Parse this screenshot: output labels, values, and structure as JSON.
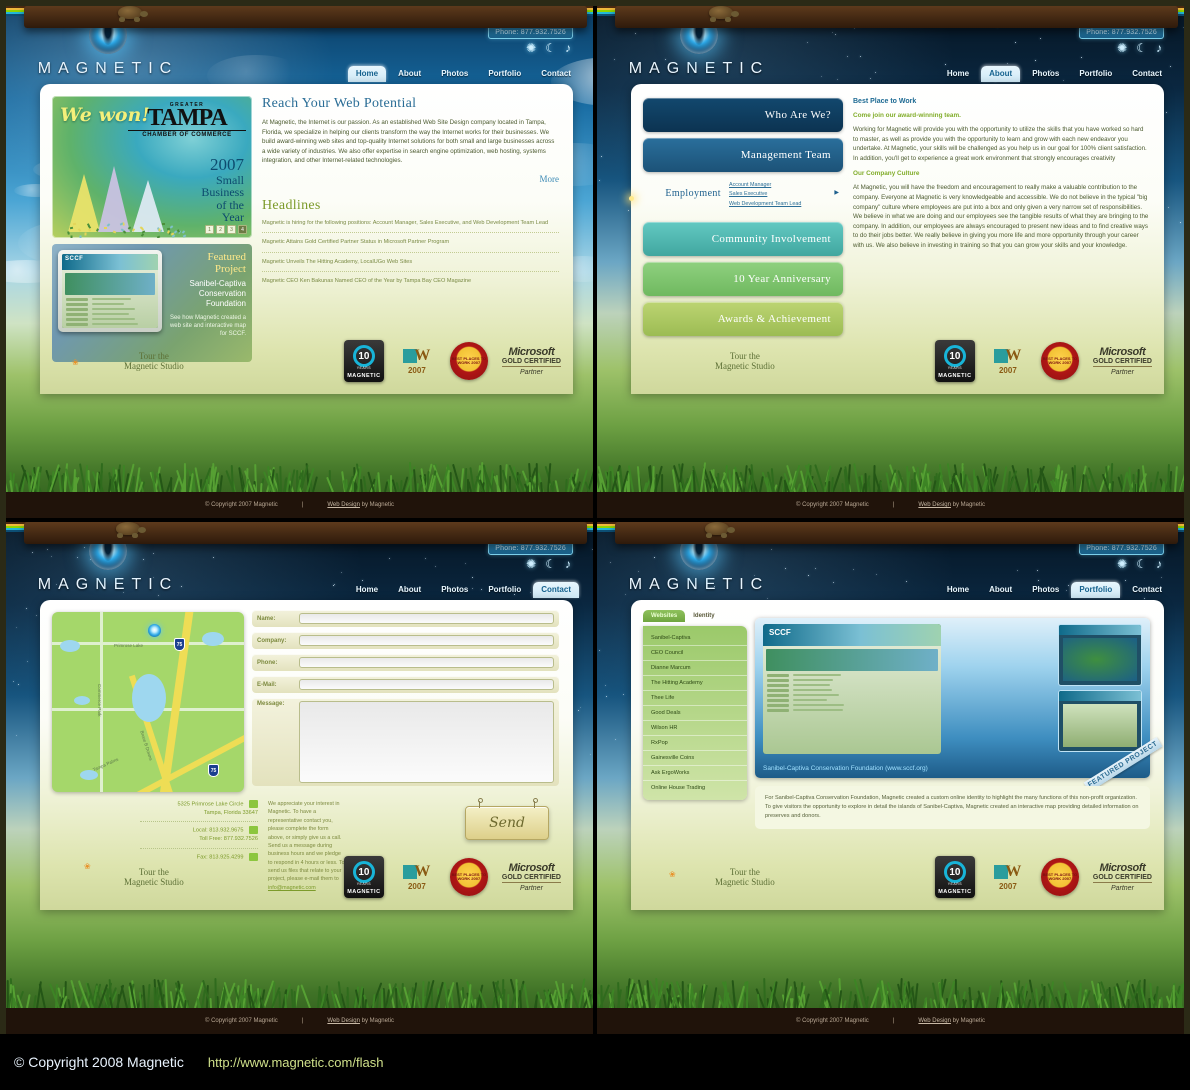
{
  "site": {
    "brand": "MAGNETIC",
    "phone_label": "Phone: 877.932.7526",
    "footer_copyright": "© Copyright 2007 Magnetic",
    "footer_sep": "|",
    "footer_credit_link": "Web Design",
    "footer_credit_rest": "by Magnetic",
    "footer_credit_by": "Magnetic",
    "tour_line1": "Tour the",
    "tour_line2": "Magnetic Studio",
    "mode_icons": [
      "sun-icon",
      "moon-icon",
      "music-note-icon"
    ],
    "nav": [
      "Home",
      "About",
      "Photos",
      "Portfolio",
      "Contact"
    ]
  },
  "badges": {
    "ten_number": "10",
    "ten_years": "YEARS",
    "ten_anniversary": "ANNIVERSARY",
    "ten_name": "MAGNETIC",
    "webby_w": "W",
    "webby_year": "2007",
    "seal_text": "BEST PLACES TO WORK 2007",
    "ms_brand": "Microsoft",
    "ms_gold": "GOLD CERTIFIED",
    "ms_partner": "Partner"
  },
  "home": {
    "active_tab": "Home",
    "hero": {
      "we_won": "We won!",
      "greater": "GREATER",
      "tampa": "TAMPA",
      "chamber": "CHAMBER OF COMMERCE",
      "year": "2007",
      "line1": "Small",
      "line2": "Business",
      "line3": "of the",
      "line4": "Year",
      "dots": [
        "1",
        "2",
        "3",
        "4"
      ]
    },
    "featured": {
      "title_line1": "Featured",
      "title_line2": "Project",
      "name": "Sanibel-Captiva Conservation Foundation",
      "desc": "See how Magnetic created a web site and interactive map for SCCF.",
      "screen_brand": "SCCF"
    },
    "reach": {
      "title": "Reach Your Web Potential",
      "body": "At Magnetic, the Internet is our passion. As an established Web Site Design company located in Tampa, Florida, we specialize in helping our clients transform the way the Internet works for their businesses. We build award-winning web sites and top-quality Internet solutions for both small and large businesses across a wide variety of industries. We also offer expertise in search engine optimization, web hosting, systems integration, and other Internet-related technologies.",
      "more": "More"
    },
    "headlines": {
      "title": "Headlines",
      "items": [
        "Magnetic is hiring for the following positions: Account Manager, Sales Executive, and Web Development Team Lead",
        "Magnetic Attains Gold Certified Partner Status in Microsoft Partner Program",
        "Magnetic Unveils The Hitting Academy, LocalUGo Web Sites",
        "Magnetic CEO Ken Bakunas Named CEO of the Year by Tampa Bay CEO Magazine"
      ]
    }
  },
  "about": {
    "active_tab": "About",
    "accordion": [
      {
        "label": "Who Are We?"
      },
      {
        "label": "Management Team"
      },
      {
        "label": "Employment",
        "links": [
          "Account Manager",
          "Sales Executive",
          "Web Development Team Lead"
        ]
      },
      {
        "label": "Community Involvement"
      },
      {
        "label": "10 Year Anniversary"
      },
      {
        "label": "Awards & Achievement"
      }
    ],
    "content": {
      "heading": "Best Place to Work",
      "sub1": "Come join our award-winning team.",
      "para1": "Working for Magnetic will provide you with the opportunity to utilize the skills that you have worked so hard to master, as well as provide you with the opportunity to learn and grow with each new endeavor you undertake. At Magnetic, your skills will be challenged as you help us in our goal for 100% client satisfaction. In addition, you'll get to experience a great work environment that strongly encourages creativity",
      "sub2": "Our Company Culture",
      "para2": "At Magnetic, you will have the freedom and encouragement to really make a valuable contribution to the company. Everyone at Magnetic is very knowledgeable and accessible. We do not believe in the typical \"big company\" culture where employees are put into a box and only given a very narrow set of responsibilities. We believe in what we are doing and our employees see the tangible results of what they are bringing to the company. In addition, our employees are always encouraged to present new ideas and to find creative ways to do their jobs better. We really believe in giving you more life and more opportunity through your career with us. We also believe in investing in training so that you can grow your skills and your knowledge."
    }
  },
  "contact": {
    "active_tab": "Contact",
    "map": {
      "labels": [
        "Primrose Lake",
        "Commerce Park",
        "Tampa Palms",
        "Bruce B Downs"
      ],
      "shields": [
        "75",
        "75"
      ]
    },
    "form": {
      "fields": [
        {
          "label": "Name:",
          "value": "",
          "placeholder": ""
        },
        {
          "label": "Company:",
          "value": "",
          "placeholder": ""
        },
        {
          "label": "Phone:",
          "value": "",
          "placeholder": ""
        },
        {
          "label": "E-Mail:",
          "value": "",
          "placeholder": ""
        }
      ],
      "message_label": "Message:",
      "message_value": "",
      "send_label": "Send"
    },
    "info": {
      "address1": "5325 Primrose Lake Circle",
      "address2": "Tampa, Florida 33647",
      "local": "Local: 813.932.9675",
      "tollfree": "Toll Free: 877.932.7526",
      "fax": "Fax: 813.925.4299"
    },
    "appreciate": "We appreciate your interest in Magnetic. To have a representative contact you, please complete the form above, or simply give us a call. Send us a message during business hours and we pledge to respond in 4 hours or less. To send us files that relate to your project, please e-mail them to",
    "email": "info@magnetic.com"
  },
  "portfolio": {
    "active_tab": "Portfolio",
    "tabs": [
      {
        "label": "Websites",
        "active": true
      },
      {
        "label": "Identity",
        "active": false
      }
    ],
    "items": [
      "Sanibel-Captiva",
      "CEO Council",
      "Dianne Marcum",
      "The Hitting Academy",
      "Thee Life",
      "Good Deals",
      "Wilson HR",
      "RxPop",
      "Gainesville Coins",
      "Ask ErgoWorks",
      "Online House Trading"
    ],
    "caption_name": "Sanibel-Captiva Conservation Foundation",
    "caption_url": "(www.sccf.org)",
    "ribbon": "FEATURED PROJECT",
    "description": "For Sanibel-Captiva Conservation Foundation, Magnetic created a custom online identity to highlight the many functions of this non-profit organization. To give visitors the opportunity to explore in detail the islands of Sanibel-Captiva, Magnetic created an interactive map providing detailed information on preserves and donors.",
    "screen_brand": "SCCF"
  },
  "bottom": {
    "copyright": "© Copyright 2008 Magnetic",
    "url": "http://www.magnetic.com/flash"
  },
  "colors": {
    "sky_day": "#4ba5d4",
    "sky_night": "#0a2740",
    "grass": "#6da043",
    "accent_blue": "#2a6d96",
    "accent_green": "#7d9b2b",
    "stage_brown": "#4b2a10"
  }
}
